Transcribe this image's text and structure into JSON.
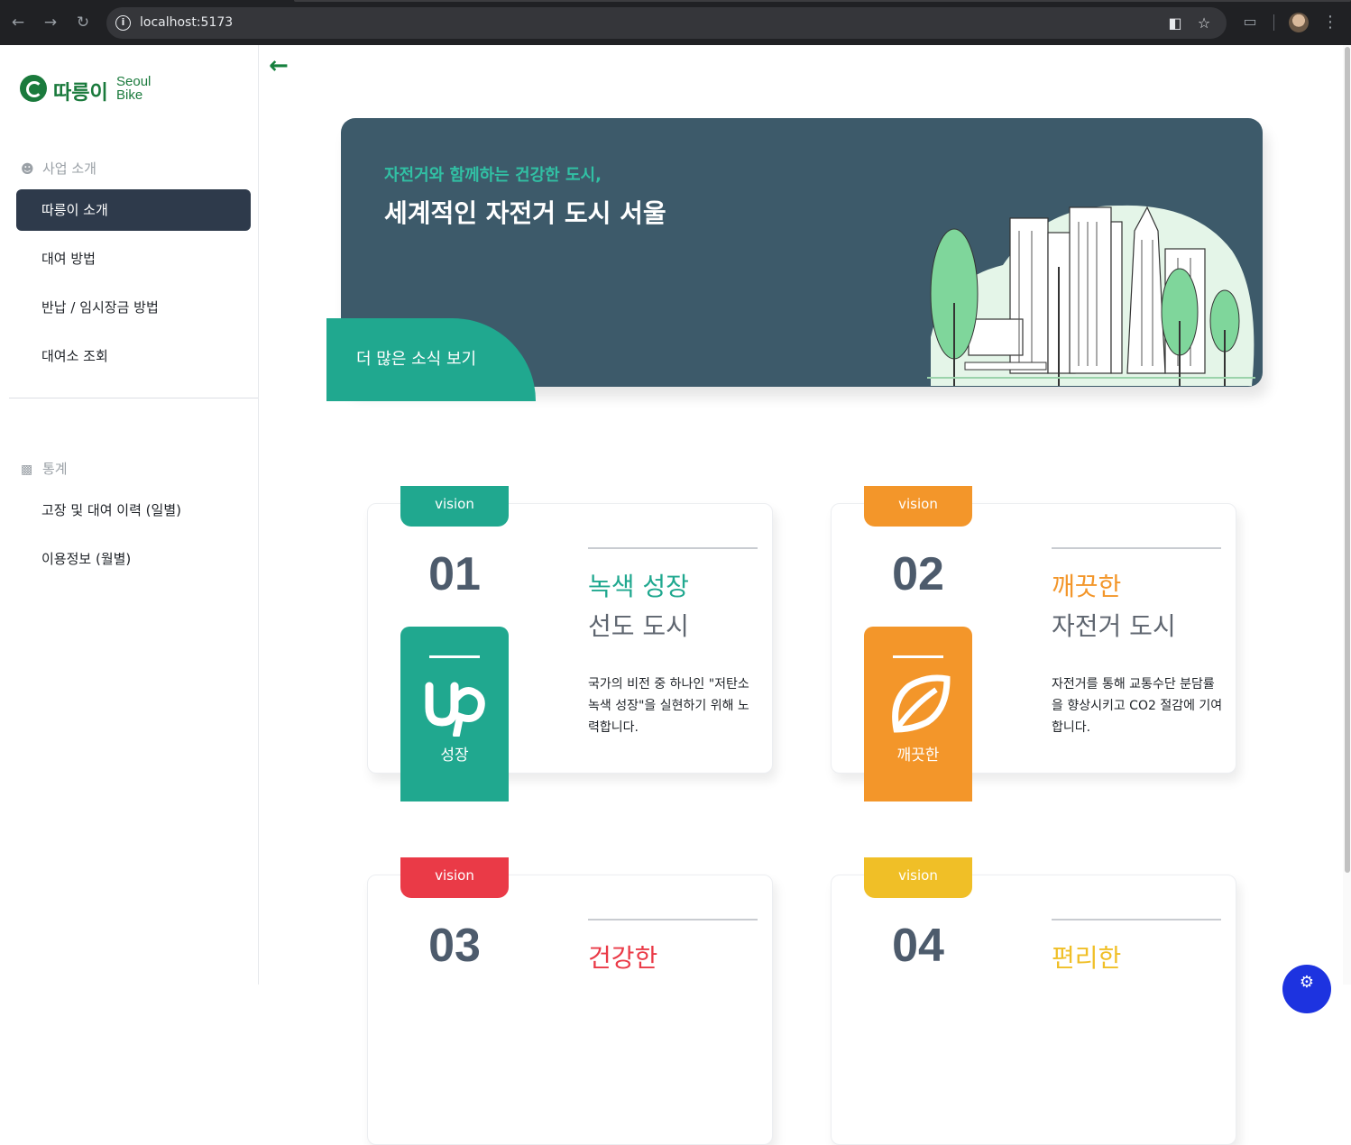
{
  "browser": {
    "url": "localhost:5173",
    "back_icon": "arrow-left-icon",
    "forward_icon": "arrow-right-icon",
    "reload_icon": "reload-icon"
  },
  "sidebar": {
    "logo": {
      "name": "따릉이",
      "sub1": "Seoul",
      "sub2": "Bike"
    },
    "section1": {
      "title": "사업 소개",
      "icon": "users-icon"
    },
    "items1": [
      {
        "label": "따릉이 소개"
      },
      {
        "label": "대여 방법"
      },
      {
        "label": "반납 / 임시장금 방법"
      },
      {
        "label": "대여소 조회"
      }
    ],
    "section2": {
      "title": "통계",
      "icon": "chart-icon"
    },
    "items2": [
      {
        "label": "고장 및 대여 이력 (일별)"
      },
      {
        "label": "이용정보 (월별)"
      }
    ]
  },
  "hero": {
    "kicker": "자전거와 함께하는 건강한 도시,",
    "title": "세계적인 자전거 도시 서울",
    "more_button": "더 많은 소식 보기"
  },
  "cards": [
    {
      "tab": "vision",
      "num": "01",
      "badge_label": "성장",
      "badge_icon": "upwork-icon",
      "h1": "녹색 성장",
      "h2": "선도 도시",
      "desc": "국가의 비전 중 하나인 \"저탄소 녹색 성장\"을 실현하기 위해 노력합니다.",
      "color": "#20a88f"
    },
    {
      "tab": "vision",
      "num": "02",
      "badge_label": "깨끗한",
      "badge_icon": "leaf-icon",
      "h1": "깨끗한",
      "h2": "자전거 도시",
      "desc": "자전거를 통해 교통수단 분담률을 향상시키고 CO2 절감에 기여합니다.",
      "color": "#f3962a"
    },
    {
      "tab": "vision",
      "num": "03",
      "h1": "건강한",
      "color": "#ea3a47"
    },
    {
      "tab": "vision",
      "num": "04",
      "h1": "편리한",
      "color": "#f0bf27"
    }
  ]
}
